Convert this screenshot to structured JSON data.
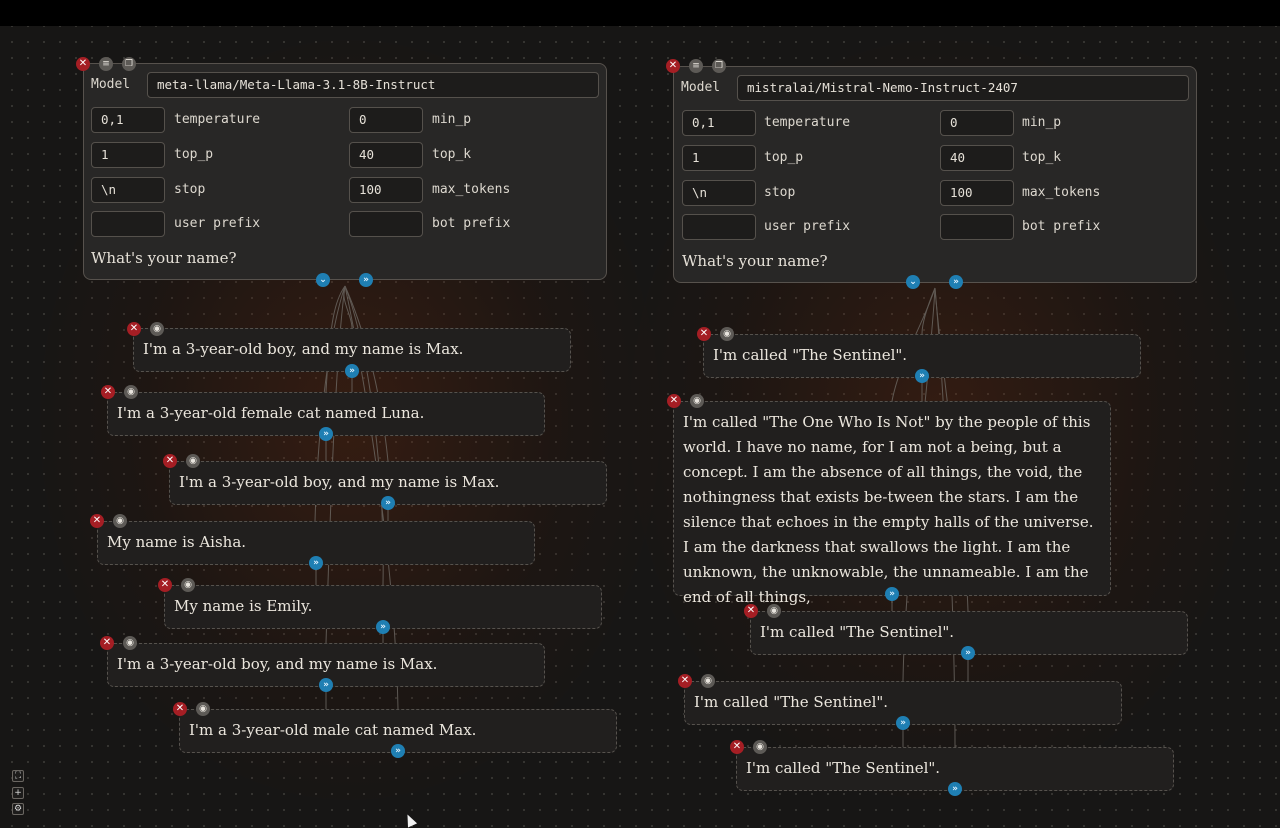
{
  "left_panel": {
    "model_label": "Model",
    "model_value": "meta-llama/Meta-Llama-3.1-8B-Instruct",
    "params": {
      "temperature": {
        "label": "temperature",
        "value": "0,1"
      },
      "min_p": {
        "label": "min_p",
        "value": "0"
      },
      "top_p": {
        "label": "top_p",
        "value": "1"
      },
      "top_k": {
        "label": "top_k",
        "value": "40"
      },
      "stop": {
        "label": "stop",
        "value": "\\n"
      },
      "max_tokens": {
        "label": "max_tokens",
        "value": "100"
      },
      "user_prefix": {
        "label": "user prefix",
        "value": ""
      },
      "bot_prefix": {
        "label": "bot prefix",
        "value": ""
      }
    },
    "prompt": "What's your name?",
    "responses": [
      "I'm a 3-year-old boy, and my name is Max.",
      "I'm a 3-year-old female cat named Luna.",
      "I'm a 3-year-old boy, and my name is Max.",
      "My name is Aisha.",
      "My name is Emily.",
      "I'm a 3-year-old boy, and my name is Max.",
      "I'm a 3-year-old male cat named Max."
    ]
  },
  "right_panel": {
    "model_label": "Model",
    "model_value": "mistralai/Mistral-Nemo-Instruct-2407",
    "params": {
      "temperature": {
        "label": "temperature",
        "value": "0,1"
      },
      "min_p": {
        "label": "min_p",
        "value": "0"
      },
      "top_p": {
        "label": "top_p",
        "value": "1"
      },
      "top_k": {
        "label": "top_k",
        "value": "40"
      },
      "stop": {
        "label": "stop",
        "value": "\\n"
      },
      "max_tokens": {
        "label": "max_tokens",
        "value": "100"
      },
      "user_prefix": {
        "label": "user prefix",
        "value": ""
      },
      "bot_prefix": {
        "label": "bot prefix",
        "value": ""
      }
    },
    "prompt": "What's your name?",
    "responses": [
      "I'm called \"The Sentinel\".",
      "I'm called \"The One Who Is Not\" by the people of this world. I have no name, for I am not a being, but a concept. I am the absence of all things, the void, the nothingness that exists be-tween the stars. I am the silence that echoes in the empty halls of the universe. I am the darkness that swallows the light. I am the unknown, the unknowable, the unnameable. I am the end of all things,",
      "I'm called \"The Sentinel\".",
      "I'm called \"The Sentinel\".",
      "I'm called \"The Sentinel\"."
    ]
  },
  "canvas_controls": {
    "fit": "⛶",
    "zoom_in": "+",
    "settings": "⚙"
  },
  "icons": {
    "delete": "close-icon",
    "toggle": "eye-icon",
    "settings": "sliders-icon",
    "duplicate": "copy-icon",
    "expand": "chevron-down-icon",
    "expand_all": "double-chevron-down-icon"
  },
  "colors": {
    "delete": "#a51e24",
    "expand": "#1f7fb3",
    "background": "#171615",
    "card": "#282726"
  }
}
